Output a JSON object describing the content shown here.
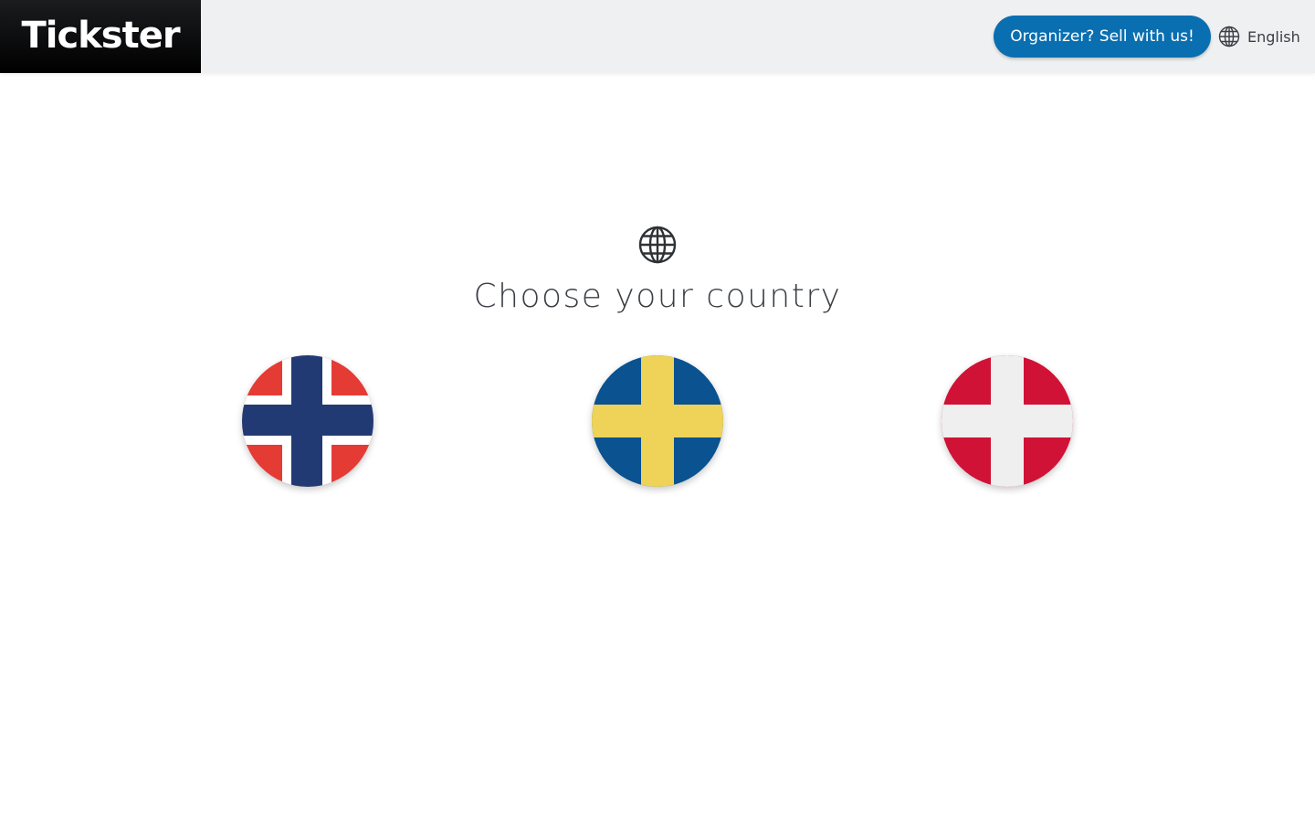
{
  "header": {
    "logo_text": "Tickster",
    "sell_button_label": "Organizer? Sell with us!",
    "language_label": "English"
  },
  "main": {
    "title": "Choose your country",
    "countries": [
      {
        "name": "Norway",
        "flag_icon": "norway-flag-icon"
      },
      {
        "name": "Sweden",
        "flag_icon": "sweden-flag-icon"
      },
      {
        "name": "Denmark",
        "flag_icon": "denmark-flag-icon"
      }
    ]
  },
  "colors": {
    "header_bg": "#eef0f2",
    "logo_bg": "#000000",
    "accent_blue": "#0a6fb0",
    "text_dark": "#3b3f44",
    "norway_red": "#e53b35",
    "norway_blue": "#223a73",
    "sweden_blue": "#0a5290",
    "sweden_yellow": "#efd358",
    "denmark_red": "#d01237",
    "denmark_white": "#efefef"
  },
  "icons": {
    "language": "globe-icon",
    "hero": "globe-icon"
  }
}
